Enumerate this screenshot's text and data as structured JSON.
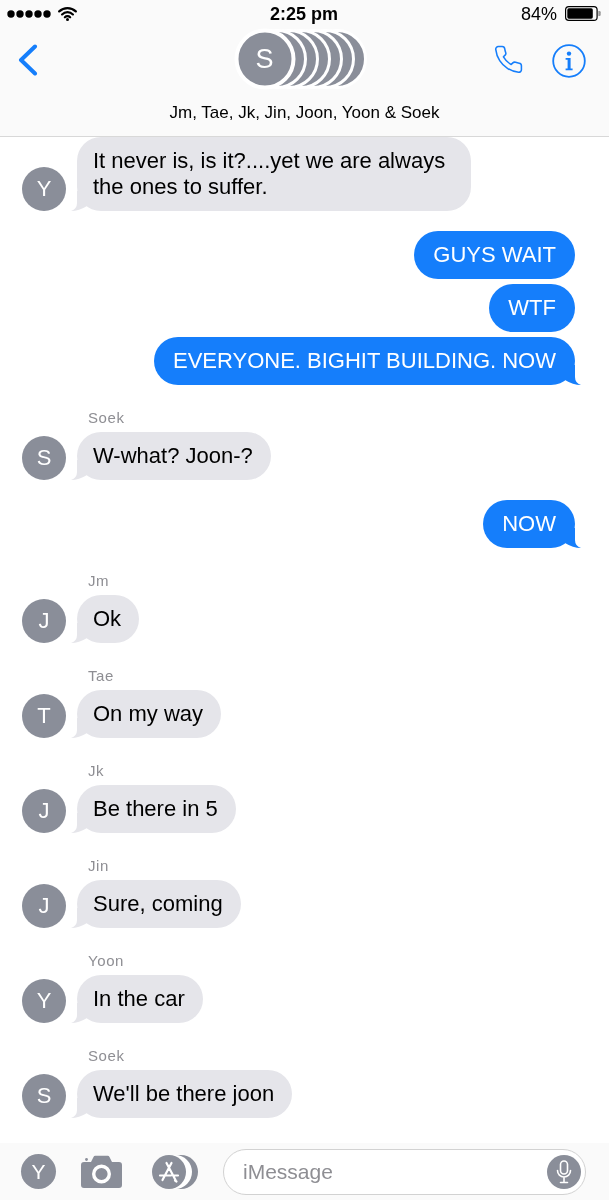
{
  "status_bar": {
    "time": "2:25 pm",
    "battery": "84%"
  },
  "header": {
    "avatar_initial": "S",
    "participants": "Jm, Tae, Jk, Jin, Joon, Yoon & Soek"
  },
  "conversation": [
    {
      "kind": "incoming",
      "avatar": "Y",
      "messages": [
        "It never is, is it?....yet we are always the ones to suffer."
      ]
    },
    {
      "kind": "outgoing",
      "messages": [
        "GUYS WAIT",
        "WTF",
        "EVERYONE. BIGHIT BUILDING. NOW"
      ]
    },
    {
      "kind": "incoming",
      "sender": "Soek",
      "avatar": "S",
      "messages": [
        "W-what? Joon-?"
      ]
    },
    {
      "kind": "outgoing",
      "messages": [
        "NOW"
      ]
    },
    {
      "kind": "incoming",
      "sender": "Jm",
      "avatar": "J",
      "messages": [
        "Ok"
      ]
    },
    {
      "kind": "incoming",
      "sender": "Tae",
      "avatar": "T",
      "messages": [
        "On my way"
      ]
    },
    {
      "kind": "incoming",
      "sender": "Jk",
      "avatar": "J",
      "messages": [
        "Be there in 5"
      ]
    },
    {
      "kind": "incoming",
      "sender": "Jin",
      "avatar": "J",
      "messages": [
        "Sure, coming"
      ]
    },
    {
      "kind": "incoming",
      "sender": "Yoon",
      "avatar": "Y",
      "messages": [
        "In the car"
      ]
    },
    {
      "kind": "incoming",
      "sender": "Soek",
      "avatar": "S",
      "messages": [
        "We'll be there joon"
      ]
    }
  ],
  "composer": {
    "avatar": "Y",
    "placeholder": "iMessage"
  }
}
